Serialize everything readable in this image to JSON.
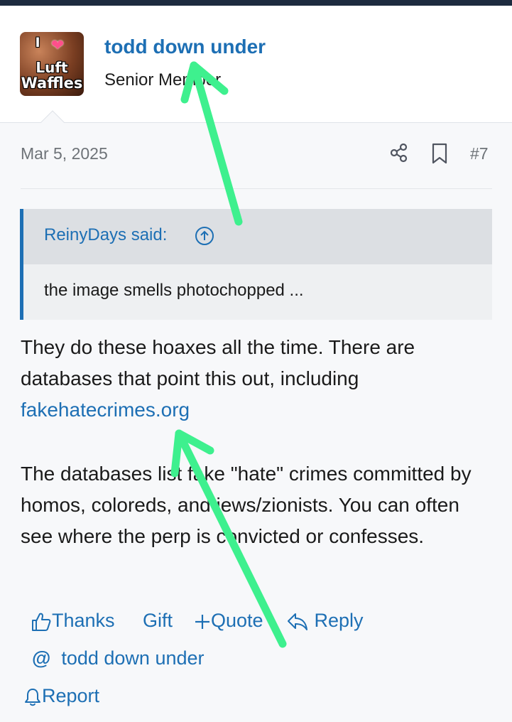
{
  "author": {
    "avatar_text": [
      "I",
      "Luft",
      "Waffles"
    ],
    "name": "todd down under",
    "title": "Senior Member"
  },
  "post": {
    "date": "Mar 5, 2025",
    "number": "#7",
    "quote": {
      "author": "ReinyDays said:",
      "text": "the image smells photochopped ..."
    },
    "paragraph1_text": "They do these hoaxes all the time. There are databases that point this out, including",
    "paragraph1_link": "fakehatecrimes.org",
    "paragraph2": "The databases list fake \"hate\" crimes committed by homos, coloreds, and jews/zionists. You can often see where the perp is convicted or confesses."
  },
  "actions": {
    "thanks": "Thanks",
    "gift": "Gift",
    "quote": "Quote",
    "reply": "Reply",
    "mention": "todd down under",
    "report": "Report"
  },
  "colors": {
    "link": "#1d6fb4",
    "arrow": "#3ef08e",
    "quote_bar": "#1d6fb4",
    "top_bar": "#1d2b3f"
  },
  "icons": [
    "share-icon",
    "bookmark-icon",
    "arrow-up-circle-icon",
    "thumbs-up-icon",
    "plus-icon",
    "reply-icon",
    "at-icon",
    "bell-icon"
  ]
}
